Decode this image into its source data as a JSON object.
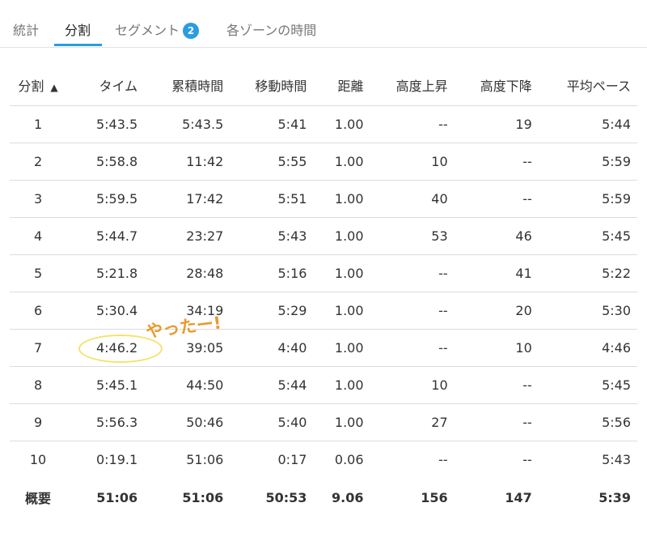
{
  "tabs": [
    {
      "label": "統計"
    },
    {
      "label": "分割"
    },
    {
      "label": "セグメント",
      "badge": "2"
    },
    {
      "label": "各ゾーンの時間"
    }
  ],
  "accent_color": "#2a9de0",
  "table": {
    "columns": [
      "分割",
      "タイム",
      "累積時間",
      "移動時間",
      "距離",
      "高度上昇",
      "高度下降",
      "平均ペース"
    ],
    "sort_indicator": "▲",
    "rows": [
      [
        "1",
        "5:43.5",
        "5:43.5",
        "5:41",
        "1.00",
        "--",
        "19",
        "5:44"
      ],
      [
        "2",
        "5:58.8",
        "11:42",
        "5:55",
        "1.00",
        "10",
        "--",
        "5:59"
      ],
      [
        "3",
        "5:59.5",
        "17:42",
        "5:51",
        "1.00",
        "40",
        "--",
        "5:59"
      ],
      [
        "4",
        "5:44.7",
        "23:27",
        "5:43",
        "1.00",
        "53",
        "46",
        "5:45"
      ],
      [
        "5",
        "5:21.8",
        "28:48",
        "5:16",
        "1.00",
        "--",
        "41",
        "5:22"
      ],
      [
        "6",
        "5:30.4",
        "34:19",
        "5:29",
        "1.00",
        "--",
        "20",
        "5:30"
      ],
      [
        "7",
        "4:46.2",
        "39:05",
        "4:40",
        "1.00",
        "--",
        "10",
        "4:46"
      ],
      [
        "8",
        "5:45.1",
        "44:50",
        "5:44",
        "1.00",
        "10",
        "--",
        "5:45"
      ],
      [
        "9",
        "5:56.3",
        "50:46",
        "5:40",
        "1.00",
        "27",
        "--",
        "5:56"
      ],
      [
        "10",
        "0:19.1",
        "51:06",
        "0:17",
        "0.06",
        "--",
        "--",
        "5:43"
      ]
    ],
    "summary": [
      "概要",
      "51:06",
      "51:06",
      "50:53",
      "9.06",
      "156",
      "147",
      "5:39"
    ]
  },
  "annotation": {
    "text": "やったー!",
    "color": "#e89a2c",
    "highlight_color": "#f3e36e"
  }
}
